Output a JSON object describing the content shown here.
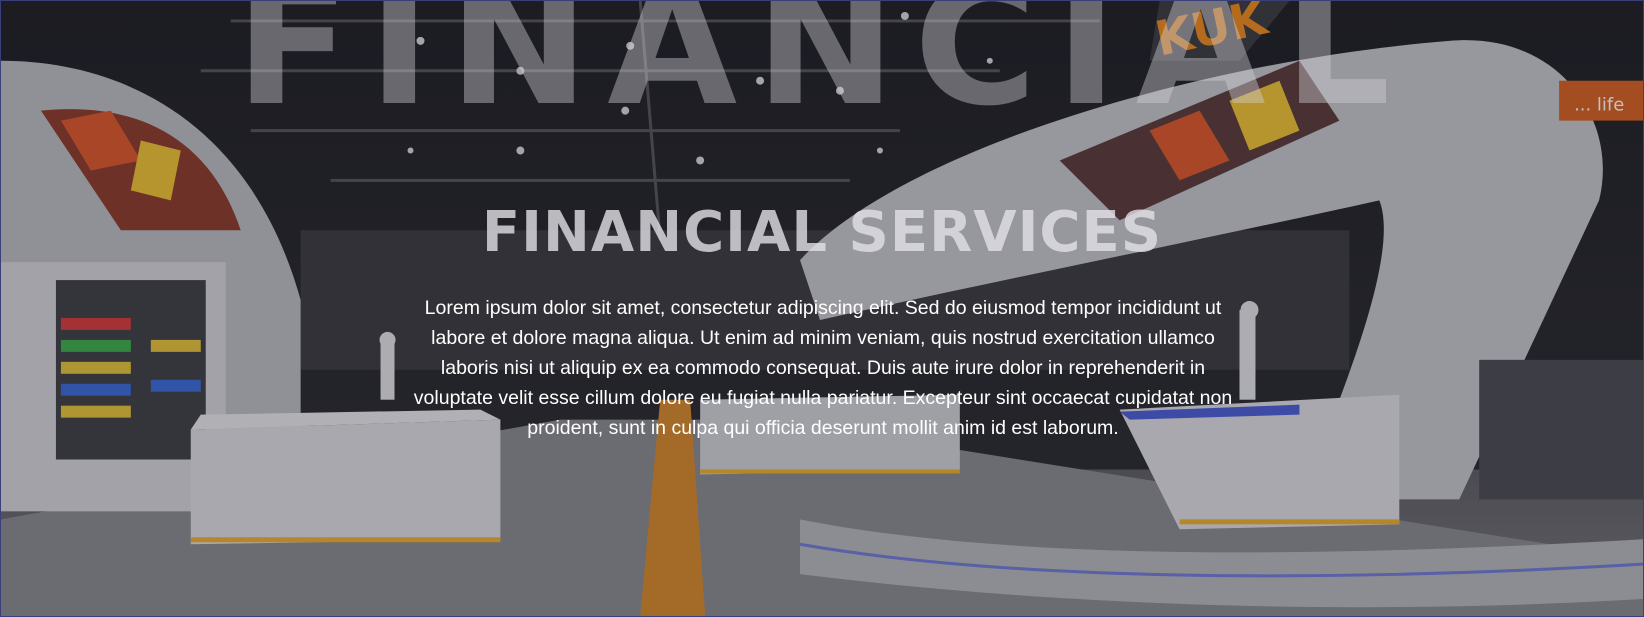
{
  "hero": {
    "watermark": "FINANCIAL",
    "title": "FINANCIAL SERVICES",
    "description": "Lorem ipsum dolor sit amet, consectetur adipiscing elit. Sed do eiusmod tempor incididunt ut labore et dolore magna aliqua. Ut enim ad minim veniam, quis nostrud exercitation ullamco laboris nisi ut aliquip ex ea commodo consequat. Duis aute irure dolor in reprehenderit in voluptate velit esse cillum dolore eu fugiat nulla pariatur. Excepteur sint occaecat cupidatat non proident, sunt in culpa qui officia deserunt mollit anim id est laborum.",
    "background_image": {
      "sign_top": "KUK",
      "sign_right": "... life"
    }
  },
  "colors": {
    "accent_orange": "#f08a1c",
    "stand_white": "#c9c9cf",
    "floor_gray": "#6d6c72",
    "border": "#3a3f7a"
  }
}
